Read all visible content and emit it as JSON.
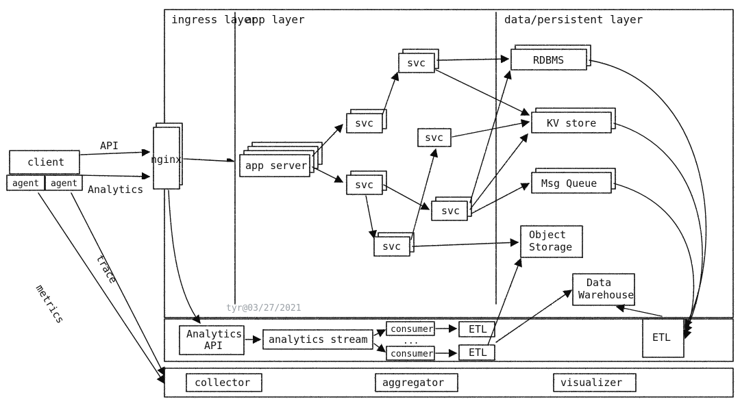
{
  "layers": {
    "ingress": "ingress layer",
    "app": "app layer",
    "data": "data/persistent layer"
  },
  "nodes": {
    "client": "client",
    "agent": "agent",
    "nginx": "nginx",
    "appserver": "app server",
    "svc": "svc",
    "rdbms": "RDBMS",
    "kv": "KV store",
    "mq": "Msg Queue",
    "obj": "Object\nStorage",
    "dwh": "Data\nWarehouse",
    "analytics_api": "Analytics\nAPI",
    "stream": "analytics stream",
    "consumer": "consumer",
    "dots": "...",
    "etl": "ETL",
    "collector": "collector",
    "aggregator": "aggregator",
    "visualizer": "visualizer"
  },
  "edges": {
    "api": "API",
    "analytics": "Analytics",
    "metrics": "metrics",
    "trace": "trace"
  },
  "credit": "tyr@03/27/2021"
}
